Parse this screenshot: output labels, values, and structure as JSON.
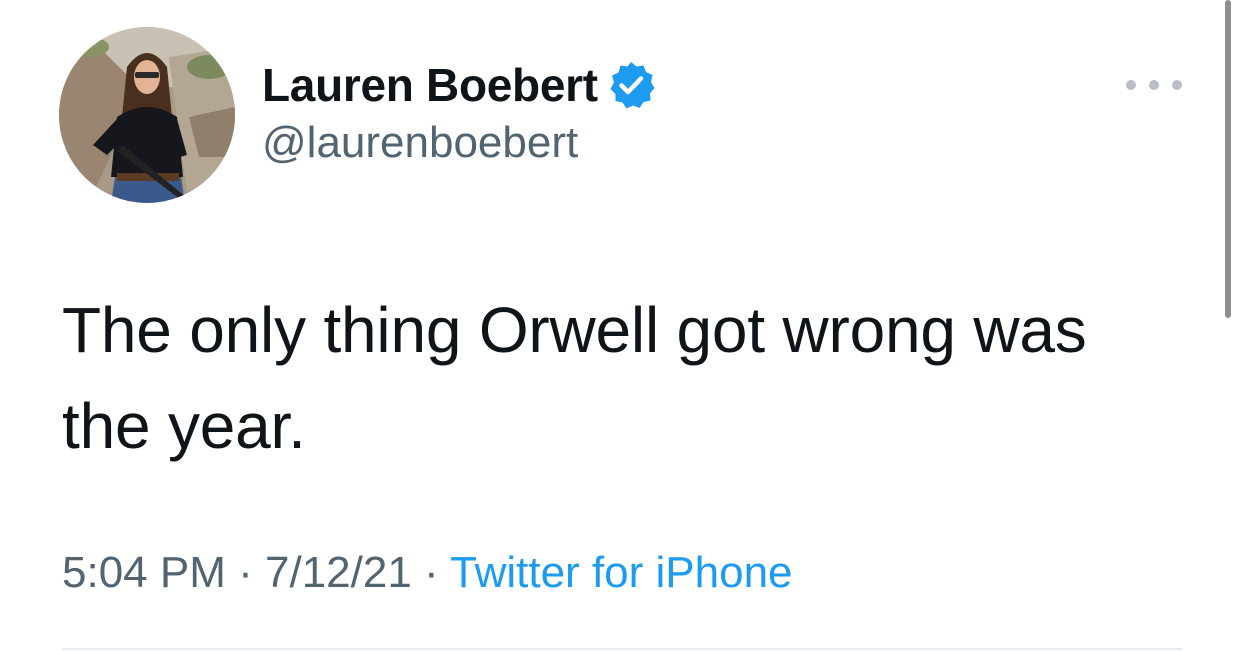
{
  "tweet": {
    "author": {
      "display_name": "Lauren Boebert",
      "handle": "@laurenboebert",
      "verified": true,
      "avatar_icon": "profile-photo"
    },
    "text": "The only thing Orwell got wrong was the year.",
    "time": "5:04 PM",
    "date": "7/12/21",
    "separator": "·",
    "source": "Twitter for iPhone",
    "more_icon": "ellipsis-icon"
  },
  "colors": {
    "text_primary": "#0f1419",
    "text_secondary": "#536471",
    "accent": "#1d9bf0",
    "verified_badge": "#1d9bf0",
    "divider": "#e6ecf0"
  }
}
